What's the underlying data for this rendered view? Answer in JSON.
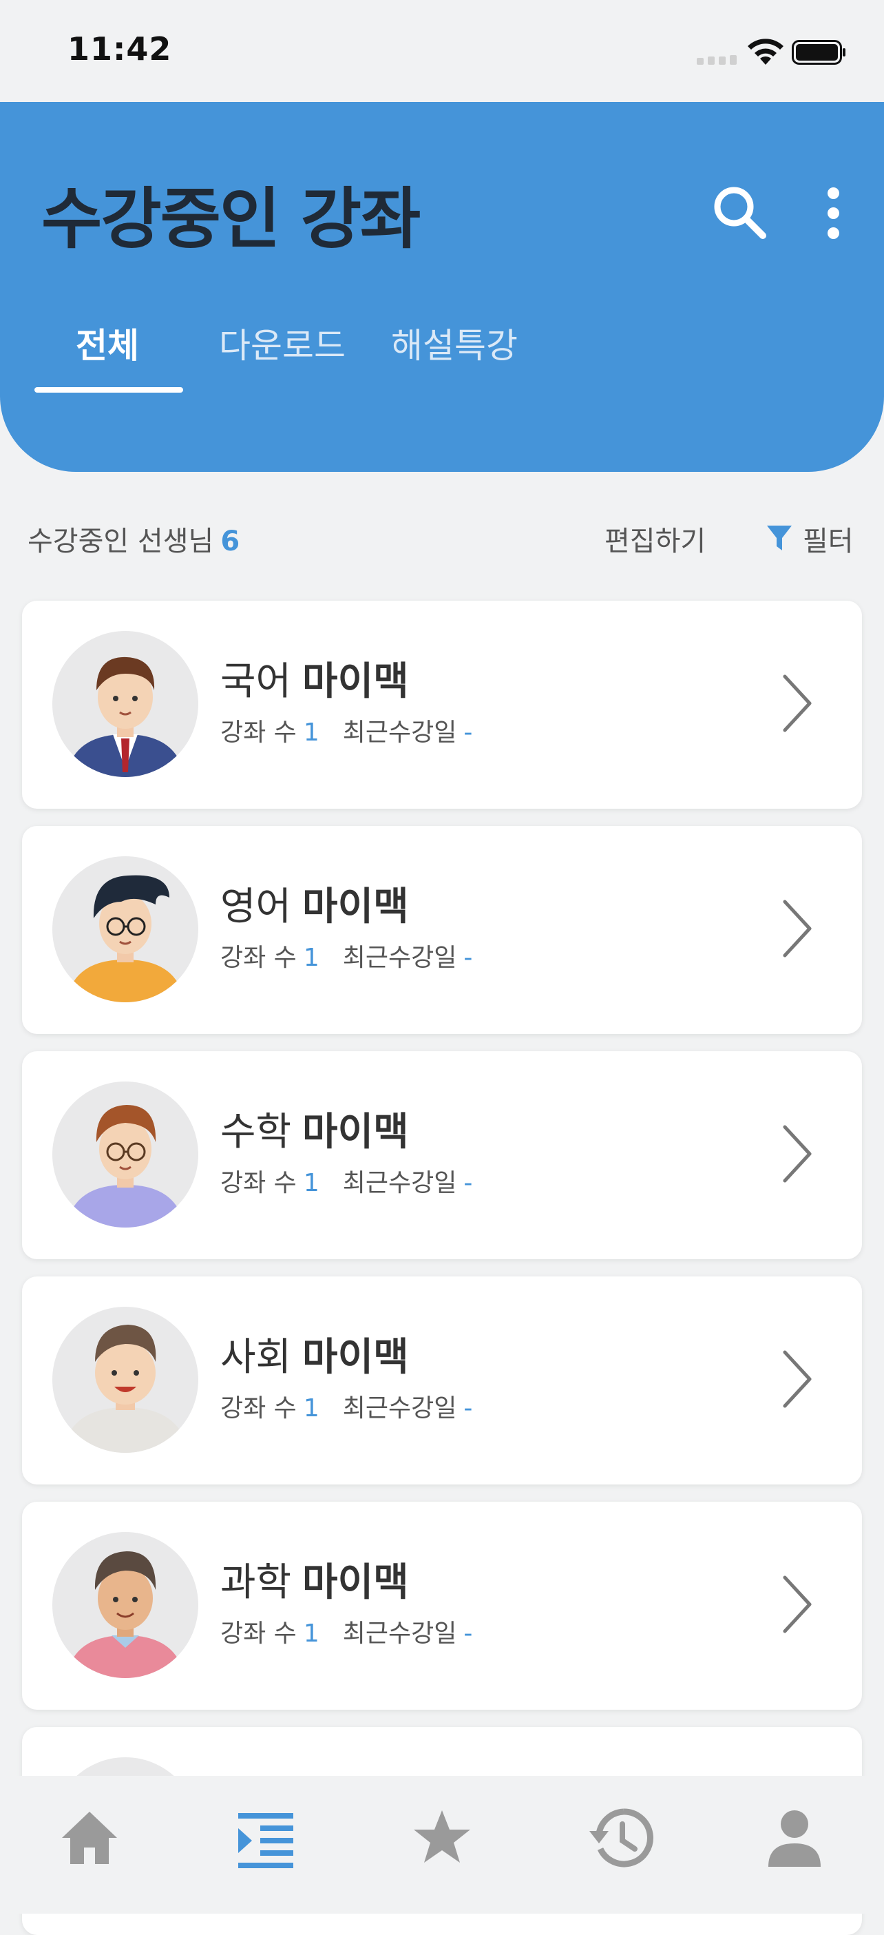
{
  "status": {
    "time": "11:42"
  },
  "header": {
    "title": "수강중인 강좌",
    "tabs": [
      {
        "label": "전체",
        "active": true
      },
      {
        "label": "다운로드",
        "active": false
      },
      {
        "label": "해설특강",
        "active": false
      }
    ]
  },
  "section": {
    "label": "수강중인 선생님",
    "count": "6",
    "edit_label": "편집하기",
    "filter_label": "필터"
  },
  "teachers": [
    {
      "subject": "국어",
      "name": "마이맥",
      "courses_label": "강좌 수",
      "courses": "1",
      "recent_label": "최근수강일",
      "recent": "-"
    },
    {
      "subject": "영어",
      "name": "마이맥",
      "courses_label": "강좌 수",
      "courses": "1",
      "recent_label": "최근수강일",
      "recent": "-"
    },
    {
      "subject": "수학",
      "name": "마이맥",
      "courses_label": "강좌 수",
      "courses": "1",
      "recent_label": "최근수강일",
      "recent": "-"
    },
    {
      "subject": "사회",
      "name": "마이맥",
      "courses_label": "강좌 수",
      "courses": "1",
      "recent_label": "최근수강일",
      "recent": "-"
    },
    {
      "subject": "과학",
      "name": "마이맥",
      "courses_label": "강좌 수",
      "courses": "1",
      "recent_label": "최근수강일",
      "recent": "-"
    }
  ],
  "nav": {
    "items": [
      "home-icon",
      "course-list-icon",
      "star-icon",
      "history-icon",
      "profile-icon"
    ],
    "active": "course-list-icon"
  },
  "colors": {
    "accent": "#4594d9",
    "background": "#f1f2f3",
    "title_text": "#1f2a37"
  }
}
